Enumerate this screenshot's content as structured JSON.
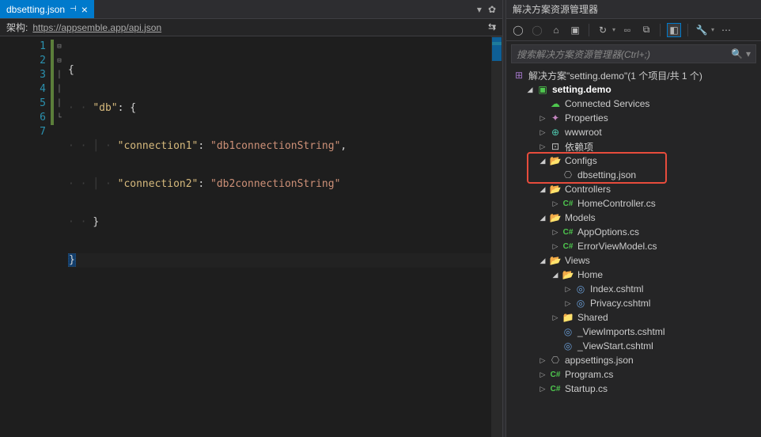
{
  "tab": {
    "title": "dbsetting.json",
    "close": "×"
  },
  "schema": {
    "label": "架构:",
    "url": "https://appsemble.app/api.json"
  },
  "code": {
    "lines": [
      "1",
      "2",
      "3",
      "4",
      "5",
      "6",
      "7"
    ],
    "l1_brace": "{",
    "l2_key": "\"db\"",
    "l2_colon": ": {",
    "l3_key": "\"connection1\"",
    "l3_val": "\"db1connectionString\"",
    "l4_key": "\"connection2\"",
    "l4_val": "\"db2connectionString\"",
    "l5_brace": "}",
    "l6_brace": "}",
    "comma": ",",
    "colon": ": "
  },
  "explorer": {
    "title": "解决方案资源管理器",
    "search_placeholder": "搜索解决方案资源管理器(Ctrl+;)",
    "solution": "解决方案\"setting.demo\"(1 个项目/共 1 个)",
    "project": "setting.demo",
    "connected": "Connected Services",
    "properties": "Properties",
    "wwwroot": "wwwroot",
    "deps": "依赖项",
    "configs": "Configs",
    "dbsetting": "dbsetting.json",
    "controllers": "Controllers",
    "homectrl": "HomeController.cs",
    "models": "Models",
    "appoptions": "AppOptions.cs",
    "errorvm": "ErrorViewModel.cs",
    "views": "Views",
    "home": "Home",
    "index": "Index.cshtml",
    "privacy": "Privacy.cshtml",
    "shared": "Shared",
    "viewimports": "_ViewImports.cshtml",
    "viewstart": "_ViewStart.cshtml",
    "appsettings": "appsettings.json",
    "program": "Program.cs",
    "startup": "Startup.cs"
  }
}
